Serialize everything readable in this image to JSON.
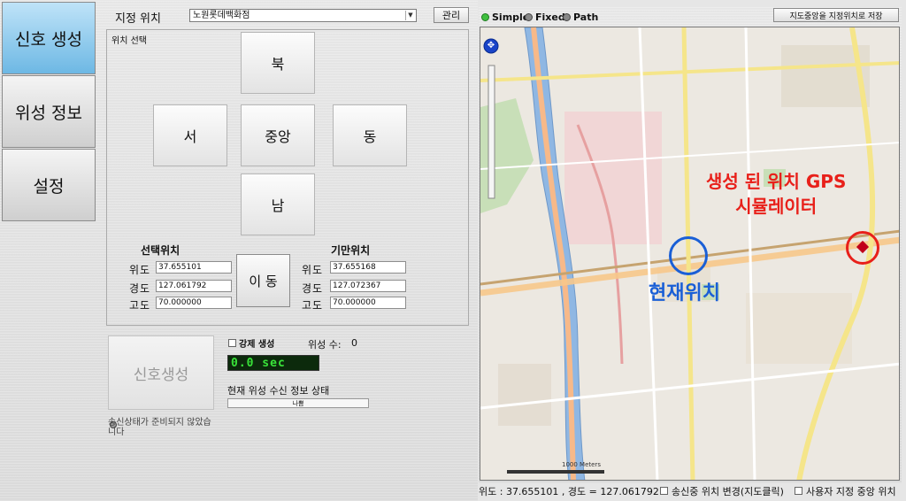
{
  "sidebar": {
    "items": [
      {
        "label": "신호 생성",
        "active": true
      },
      {
        "label": "위성 정보",
        "active": false
      },
      {
        "label": "설정",
        "active": false
      }
    ]
  },
  "location": {
    "label": "지정 위치",
    "selected": "노원롯데백화점",
    "manage_button": "관리"
  },
  "position_select": {
    "title": "위치 선택",
    "north": "북",
    "west": "서",
    "center": "중앙",
    "east": "동",
    "south": "남"
  },
  "selected_position": {
    "header": "선택위치",
    "lat_label": "위도",
    "lon_label": "경도",
    "alt_label": "고도",
    "lat": "37.655101",
    "lon": "127.061792",
    "alt": "70.000000"
  },
  "deception_position": {
    "header": "기만위치",
    "lat_label": "위도",
    "lon_label": "경도",
    "alt_label": "고도",
    "lat": "37.655168",
    "lon": "127.072367",
    "alt": "70.000000"
  },
  "move_button": "이 동",
  "signal": {
    "button_label": "신호생성",
    "force_label": "강제 생성",
    "sat_count_label": "위성 수:",
    "sat_count": "0",
    "timer": "0.0 sec",
    "status_title": "현재 위성 수신 정보 상태",
    "status_value": "나쁨",
    "note": "송신상태가 준비되지 않았습니다"
  },
  "map": {
    "modes": [
      "Simple",
      "Fixed",
      "Path"
    ],
    "active_mode": "Simple",
    "save_button": "지도중앙을 지정위치로 저장",
    "annotation_generated": "생성 된 위치 GPS\n시뮬레이터",
    "annotation_current": "현재위치",
    "scale_label": "1000 Meters",
    "colors": {
      "annotation_red": "#e8201a",
      "annotation_blue": "#1a5fd6",
      "river": "#8fb7e3",
      "rail": "#e6a0a0"
    }
  },
  "bottom_bar": {
    "coords": "위도 : 37.655101 , 경도 = 127.061792",
    "option1": "송신중 위치 변경(지도클릭)",
    "option2": "사용자 지정 중앙 위치"
  }
}
